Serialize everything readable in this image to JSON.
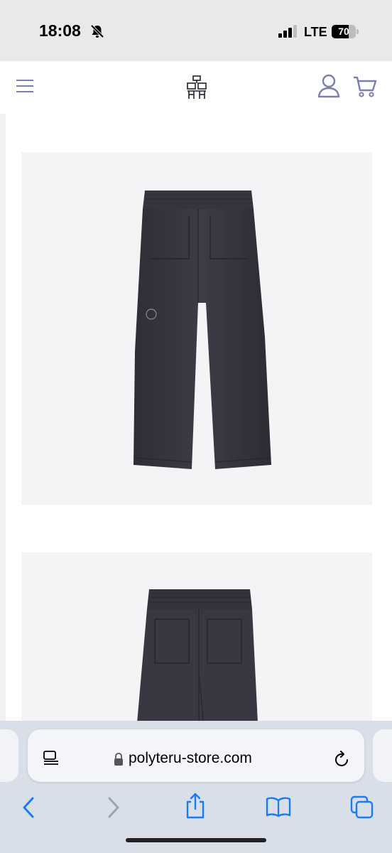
{
  "status_bar": {
    "time": "18:08",
    "network": "LTE",
    "battery_level": "70",
    "battery_fraction": 0.7
  },
  "header": {
    "menu_icon": "hamburger-menu-icon",
    "logo_icon": "polyteru-logo",
    "account_icon": "user-icon",
    "cart_icon": "cart-icon",
    "icon_color": "#7c7fae"
  },
  "products": {
    "image_1": {
      "subject": "pants-front"
    },
    "image_2": {
      "subject": "pants-back"
    }
  },
  "browser": {
    "url": "polyteru-store.com",
    "accent_color": "#1a7cf5"
  }
}
